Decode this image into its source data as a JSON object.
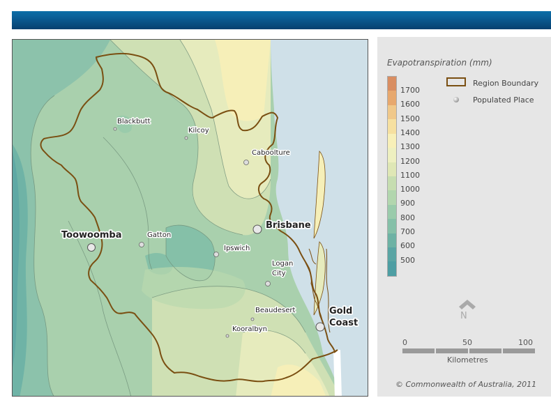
{
  "legend": {
    "title": "Evapotranspiration (mm)",
    "ticks": [
      "1700",
      "1600",
      "1500",
      "1400",
      "1300",
      "1200",
      "1100",
      "1000",
      "900",
      "800",
      "700",
      "600",
      "500"
    ],
    "ramp_colors": [
      "#d98e62",
      "#e7a86e",
      "#f0c88a",
      "#f6e0a0",
      "#f8f0b8",
      "#eef0c0",
      "#dfe7b5",
      "#c6ddb0",
      "#b2d6ae",
      "#9acbab",
      "#85c0a8",
      "#6db2a4",
      "#5aa5a4"
    ],
    "region_boundary_label": "Region Boundary",
    "populated_place_label": "Populated Place",
    "boundary_color": "#7a4f12"
  },
  "north_arrow": {
    "label": "N"
  },
  "scale_bar": {
    "labels": [
      "0",
      "50",
      "100"
    ],
    "unit": "Kilometres"
  },
  "copyright": "© Commonwealth of Australia, 2011",
  "places": {
    "blackbutt": "Blackbutt",
    "kilcoy": "Kilcoy",
    "caboolture": "Caboolture",
    "toowoomba": "Toowoomba",
    "gatton": "Gatton",
    "ipswich": "Ipswich",
    "brisbane": "Brisbane",
    "logan_line1": "Logan",
    "logan_line2": "City",
    "beaudesert": "Beaudesert",
    "kooralbyn": "Kooralbyn",
    "goldcoast_line1": "Gold",
    "goldcoast_line2": "Coast"
  },
  "colors": {
    "ocean": "#cfe0e8",
    "banner": "#0b5c93"
  }
}
